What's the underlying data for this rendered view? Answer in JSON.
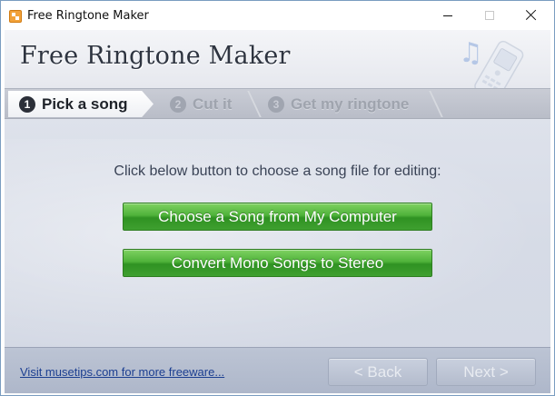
{
  "window": {
    "title": "Free Ringtone Maker"
  },
  "header": {
    "app_title": "Free Ringtone Maker",
    "deco_note": "♫"
  },
  "steps": [
    {
      "number": "1",
      "label": "Pick a song",
      "state": "active"
    },
    {
      "number": "2",
      "label": "Cut it",
      "state": "disabled"
    },
    {
      "number": "3",
      "label": "Get my ringtone",
      "state": "disabled"
    }
  ],
  "main": {
    "instruction": "Click below button to choose a song file for editing:",
    "choose_button": "Choose a Song from My Computer",
    "convert_button": "Convert Mono Songs to Stereo"
  },
  "footer": {
    "link_text": "Visit musetips.com for more freeware...",
    "back_button": "< Back",
    "next_button": "Next >"
  },
  "colors": {
    "accent_green": "#4fb23a",
    "link_blue": "#1c3f91",
    "active_step_bg": "#ffffff",
    "disabled_text": "#9fa4ae"
  }
}
